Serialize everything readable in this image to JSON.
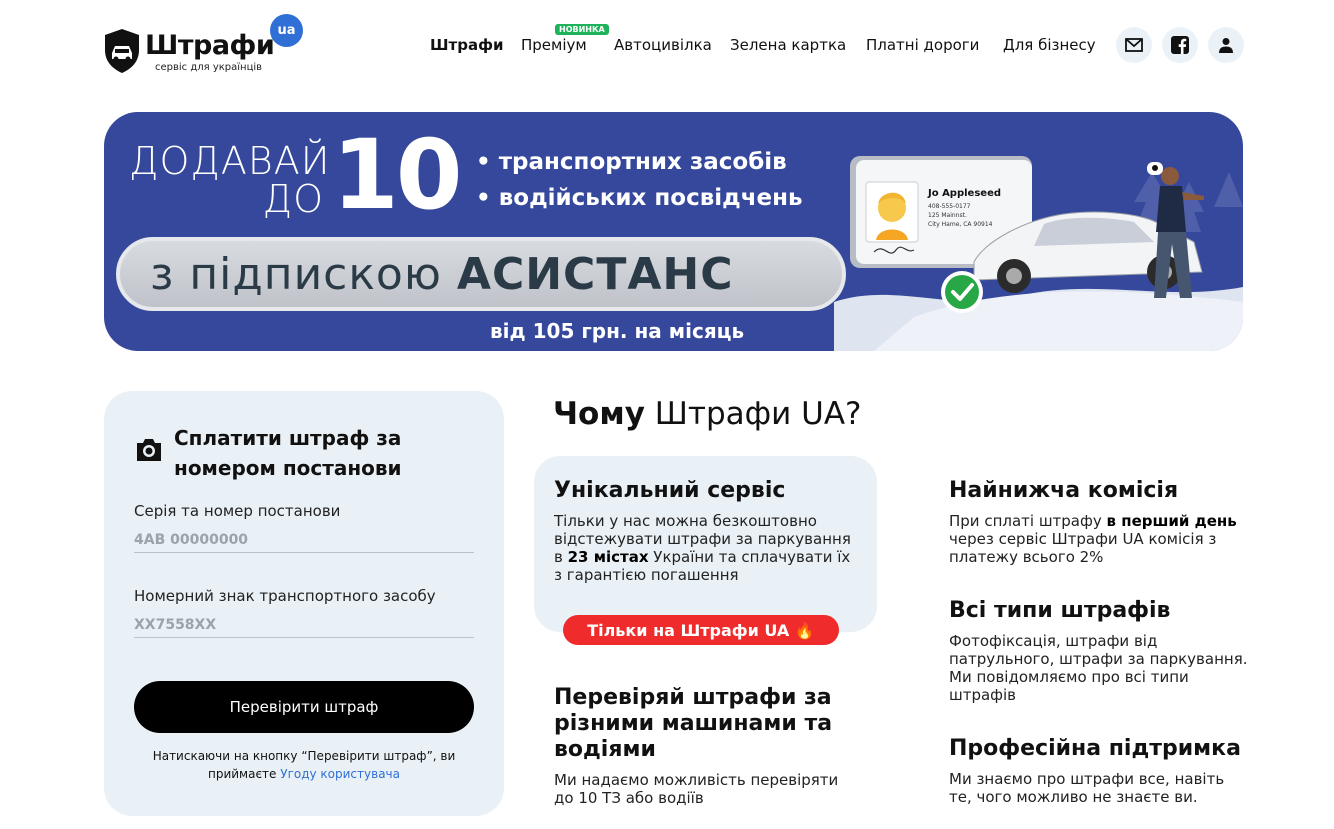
{
  "header": {
    "logo": {
      "name": "Штрафи",
      "badge": "ua",
      "subtitle": "сервіс для українців"
    },
    "nav": [
      {
        "label": "Штрафи",
        "active": true
      },
      {
        "label": "Преміум",
        "badge": "НОВИНКА"
      },
      {
        "label": "Автоцивілка"
      },
      {
        "label": "Зелена картка"
      },
      {
        "label": "Платні дороги"
      },
      {
        "label": "Для бізнесу"
      }
    ],
    "icons": [
      "mail-icon",
      "facebook-icon",
      "user-icon"
    ]
  },
  "banner": {
    "add_line1": "ДОДАВАЙ",
    "add_line2": "ДО",
    "count": "10",
    "bullets": [
      "транспортних засобів",
      "водійських посвідчень"
    ],
    "pill_prefix": "з підпискою",
    "pill_bold": "АСИСТАНС",
    "price": "від 105 грн. на місяць",
    "card": {
      "name": "Jo Appleseed",
      "line1": "408-555-0177",
      "line2": "125 Mainnst.",
      "line3": "City Hame, CA 90914"
    }
  },
  "pay": {
    "title": "Сплатити штраф за номером постанови",
    "series_label": "Серія та номер постанови",
    "series_placeholder": "4АВ 00000000",
    "plate_label": "Номерний знак транспортного засобу",
    "plate_placeholder": "XX7558XX",
    "button": "Перевірити штраф",
    "terms_text": "Натискаючи на кнопку “Перевірити штраф”, ви приймаєте",
    "terms_link": "Угоду користувача"
  },
  "why": {
    "title_bold": "Чому",
    "title_rest": "Штрафи UA?",
    "unique": {
      "title": "Унікальний сервіс",
      "text_a": "Тільки у нас можна безкоштовно відстежувати штрафи за паркування в",
      "text_bold": "23 містах",
      "text_b": "України та сплачувати їх з гарантією погашення",
      "badge": "Тільки на Штрафи UA 🔥"
    },
    "check": {
      "title": "Перевіряй штрафи за різними машинами та водіями",
      "text": "Ми надаємо можливість перевіряти до 10 ТЗ або водіїв"
    },
    "commission": {
      "title": "Найнижча комісія",
      "text_a": "При сплаті штрафу",
      "text_bold": "в перший день",
      "text_b": "через сервіс Штрафи UA комісія з платежу всього 2%"
    },
    "types": {
      "title": "Всі типи штрафів",
      "text": "Фотофіксація, штрафи від патрульного, штрафи за паркування. Ми повідомляємо про всі типи штрафів"
    },
    "support": {
      "title": "Професійна підтримка",
      "text": "Ми знаємо про штрафи все, навіть те, чого можливо не знаєте ви."
    }
  }
}
